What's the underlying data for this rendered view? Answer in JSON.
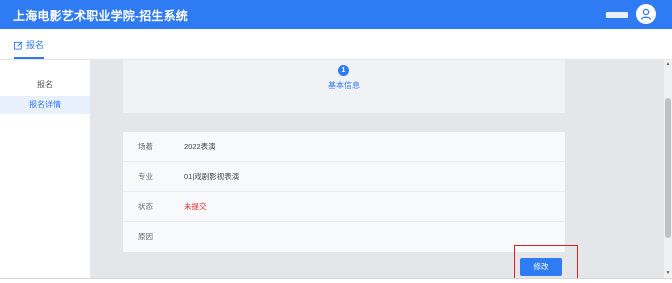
{
  "header": {
    "title": "上海电影艺术职业学院-招生系统"
  },
  "navbar": {
    "tab_label": "报名"
  },
  "sidebar": {
    "items": [
      {
        "label": "报名"
      },
      {
        "label": "报名详情"
      }
    ]
  },
  "step": {
    "number": "1",
    "label": "基本信息"
  },
  "info": {
    "rows": [
      {
        "label": "场着",
        "value": "2022表演"
      },
      {
        "label": "专业",
        "value": "01|戏剧影视表演"
      },
      {
        "label": "状态",
        "value": "未提交"
      },
      {
        "label": "原因",
        "value": ""
      }
    ]
  },
  "actions": {
    "modify_label": "修改"
  },
  "colors": {
    "primary": "#2f7bf3",
    "status_red": "#e02b2b"
  }
}
